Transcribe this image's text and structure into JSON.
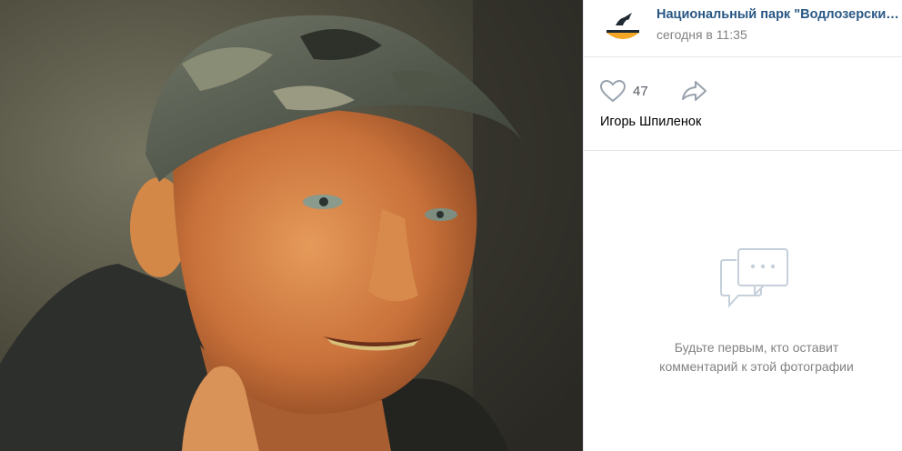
{
  "post": {
    "author_name": "Национальный парк \"Водлозерский\"",
    "time": "сегодня в 11:35"
  },
  "actions": {
    "like_count": "47"
  },
  "photo": {
    "author": "Игорь Шпиленок"
  },
  "comments": {
    "empty_line1": "Будьте первым, кто оставит",
    "empty_line2": "комментарий к этой фотографии"
  },
  "colors": {
    "link": "#2a5885",
    "muted": "#828282",
    "icon": "#99a2ad",
    "divider": "#e7e8ec"
  },
  "icons": [
    "heart-icon",
    "share-icon",
    "comments-empty-icon",
    "park-logo-icon"
  ]
}
